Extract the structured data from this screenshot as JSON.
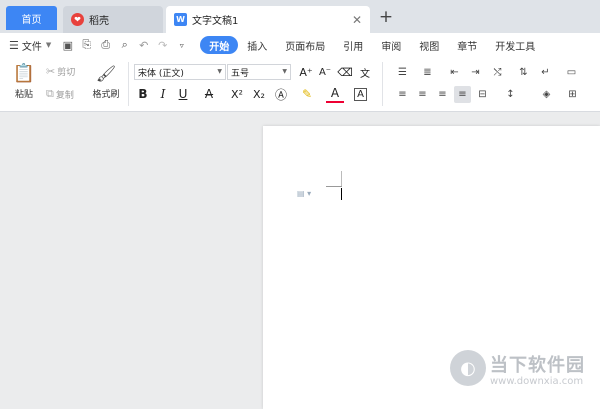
{
  "tabs": {
    "home": "首页",
    "doc1": "稻壳",
    "doc2": "文字文稿1",
    "add": "+",
    "close": "✕"
  },
  "menu": {
    "file": "文件",
    "items": [
      "开始",
      "插入",
      "页面布局",
      "引用",
      "审阅",
      "视图",
      "章节",
      "开发工具"
    ],
    "active_index": 0
  },
  "ribbon": {
    "paste": "粘贴",
    "cut": "剪切",
    "copy": "复制",
    "format_painter": "格式刷",
    "font_name": "宋体 (正文)",
    "font_size": "五号"
  },
  "watermark": {
    "name": "当下软件园",
    "url": "www.downxia.com"
  },
  "colors": {
    "accent": "#3d86f4",
    "tab_icon_wps": "#3d86f4",
    "tab_icon_docer": "#e8413c"
  }
}
